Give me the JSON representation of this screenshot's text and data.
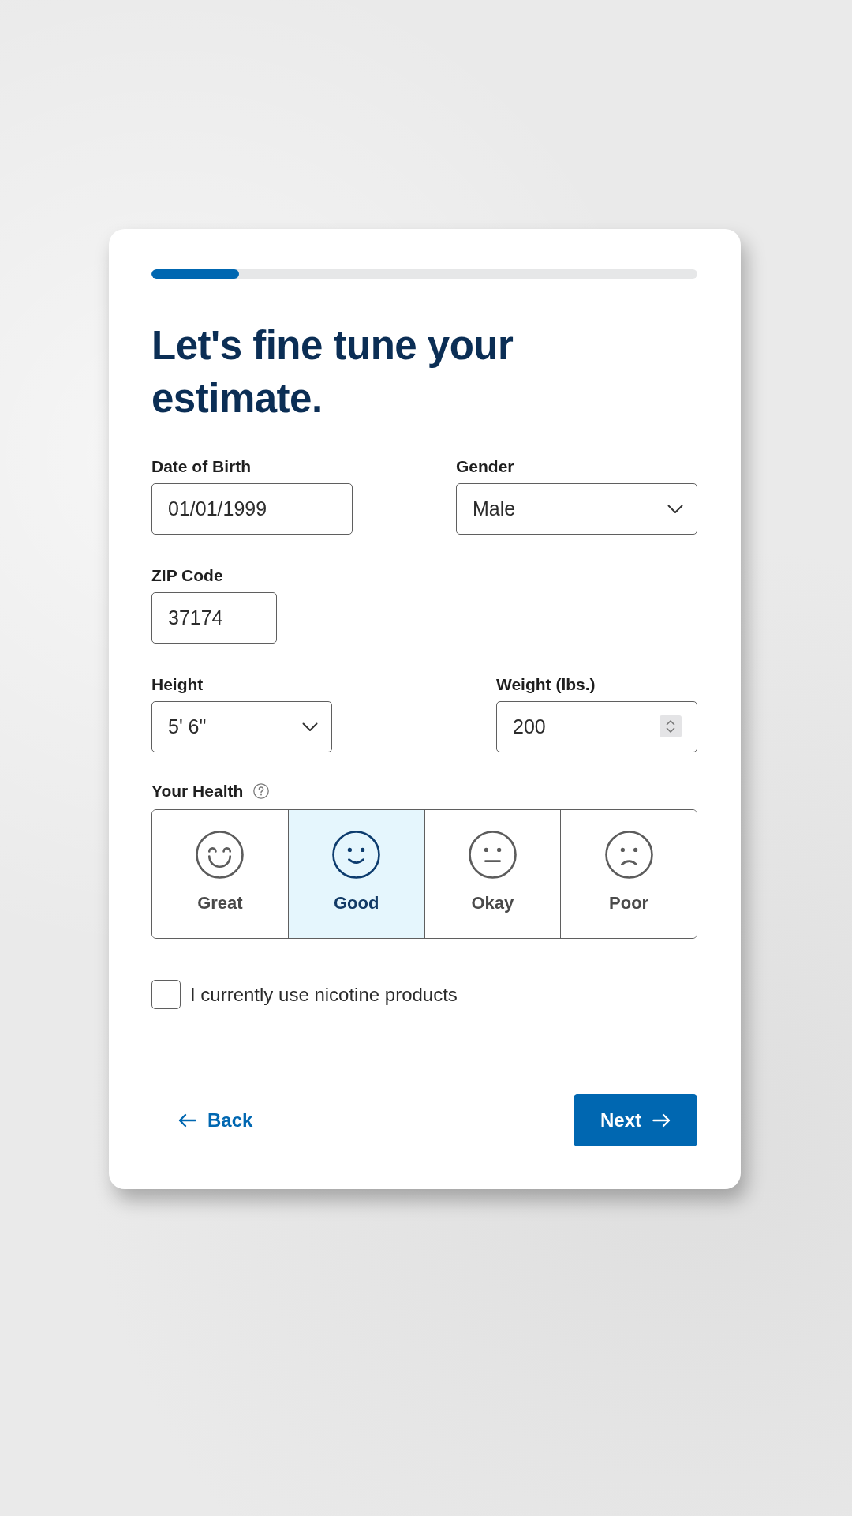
{
  "progress": {
    "level": 0.16
  },
  "title": "Let's fine tune your estimate.",
  "field_rows": [
    [
      {
        "kind": "text",
        "label": "Date of Birth",
        "value": "01/01/1999"
      },
      {
        "kind": "select",
        "label": "Gender",
        "value": "Male"
      }
    ],
    [
      {
        "kind": "text",
        "label": "ZIP Code",
        "value": "37174"
      }
    ],
    [
      {
        "kind": "select",
        "label": "Height",
        "value": "5' 6\""
      },
      {
        "kind": "number",
        "label": "Weight (lbs.)",
        "value": "200"
      }
    ]
  ],
  "health": {
    "label": "Your Health",
    "options": [
      {
        "kind": "laughing",
        "label": "Great",
        "selected": false
      },
      {
        "kind": "smiling",
        "label": "Good",
        "selected": true
      },
      {
        "kind": "neutral",
        "label": "Okay",
        "selected": false
      },
      {
        "kind": "frowning",
        "label": "Poor",
        "selected": false
      }
    ]
  },
  "nicotine": {
    "label": "I currently use nicotine products",
    "checked": false
  },
  "buttons": {
    "back": "Back",
    "next": "Next"
  }
}
